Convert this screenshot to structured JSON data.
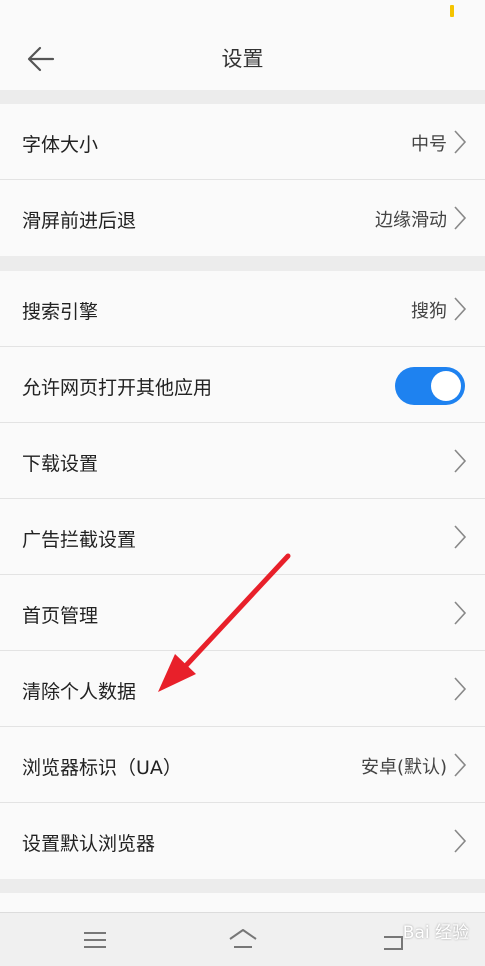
{
  "header": {
    "title": "设置"
  },
  "groups": [
    {
      "items": [
        {
          "label": "字体大小",
          "value": "中号"
        },
        {
          "label": "滑屏前进后退",
          "value": "边缘滑动"
        }
      ]
    },
    {
      "items": [
        {
          "label": "搜索引擎",
          "value": "搜狗"
        },
        {
          "label": "允许网页打开其他应用",
          "toggle_on": true
        },
        {
          "label": "下载设置"
        },
        {
          "label": "广告拦截设置"
        },
        {
          "label": "首页管理"
        },
        {
          "label": "清除个人数据"
        },
        {
          "label": "浏览器标识（UA）",
          "value": "安卓(默认)"
        },
        {
          "label": "设置默认浏览器"
        }
      ]
    }
  ],
  "watermark": "Bai 经验",
  "icons": {
    "back": "arrow-left-icon",
    "chevron": "chevron-right-icon",
    "nav_menu": "menu-icon",
    "nav_home": "home-icon",
    "nav_back": "back-icon"
  },
  "colors": {
    "toggle_on": "#1e82f0",
    "annotation_arrow": "#e8202a",
    "status_battery": "#f5c400"
  }
}
